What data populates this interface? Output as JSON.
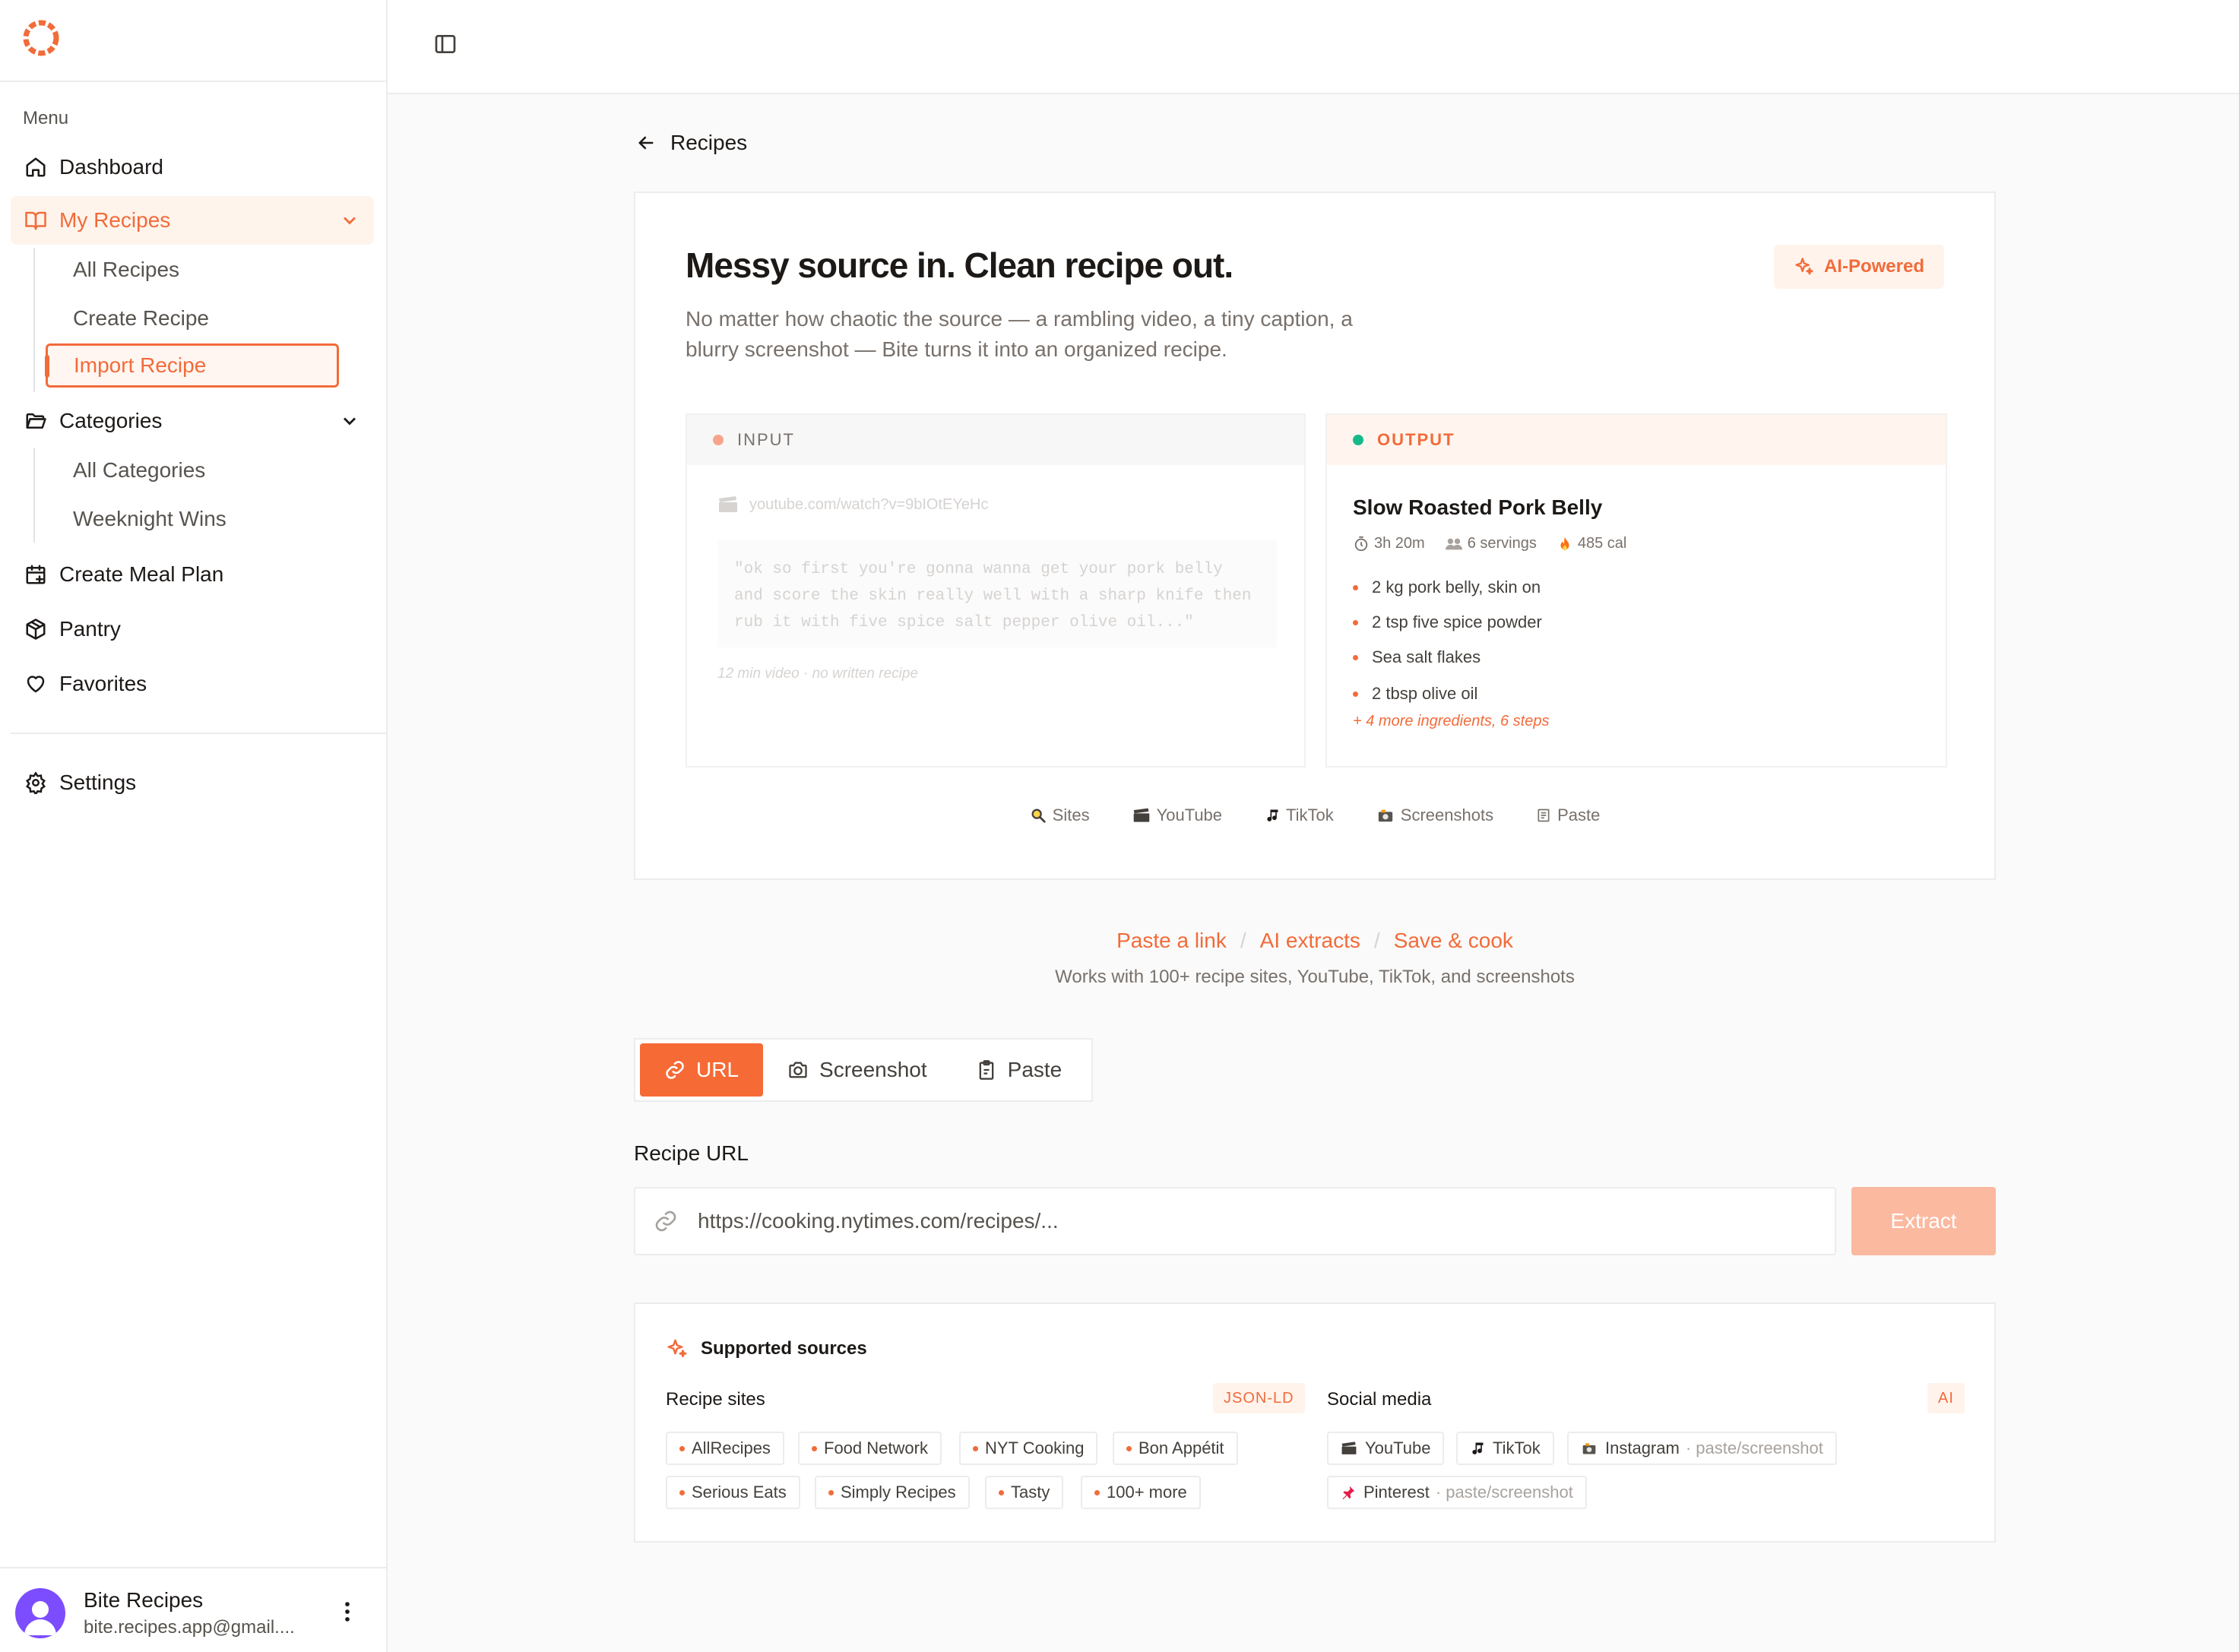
{
  "sidebar": {
    "menu_label": "Menu",
    "items": {
      "dashboard": "Dashboard",
      "my_recipes": "My Recipes",
      "all_recipes": "All Recipes",
      "create_recipe": "Create Recipe",
      "import_recipe": "Import Recipe",
      "categories": "Categories",
      "all_categories": "All Categories",
      "weeknight_wins": "Weeknight Wins",
      "meal_plan": "Create Meal Plan",
      "pantry": "Pantry",
      "favorites": "Favorites",
      "settings": "Settings"
    },
    "user": {
      "name": "Bite Recipes",
      "email": "bite.recipes.app@gmail...."
    }
  },
  "colors": {
    "accent": "#f26b3a",
    "accent_light": "#fff3ec",
    "avatar": "#7c4dff",
    "output_dot": "#16b98a",
    "input_dot": "#f7a58a"
  },
  "back_label": "Recipes",
  "hero": {
    "title": "Messy source in. Clean recipe out.",
    "description": "No matter how chaotic the source — a rambling video, a tiny caption, a blurry screenshot — Bite turns it into an organized recipe.",
    "badge": "AI-Powered",
    "input": {
      "header": "INPUT",
      "url": "youtube.com/watch?v=9bIOtEYeHc",
      "quote": "\"ok so first you're gonna wanna get your pork belly and score the skin really well with a sharp knife then rub it with five spice salt pepper olive oil...\"",
      "note": "12 min video · no written recipe"
    },
    "output": {
      "header": "OUTPUT",
      "title": "Slow Roasted Pork Belly",
      "time": "3h 20m",
      "servings": "6 servings",
      "calories": "485 cal",
      "ingredients": [
        "2 kg pork belly, skin on",
        "2 tsp five spice powder",
        "Sea salt flakes",
        "2 tbsp olive oil"
      ],
      "more": "+ 4 more ingredients, 6 steps"
    },
    "sources": [
      "Sites",
      "YouTube",
      "TikTok",
      "Screenshots",
      "Paste"
    ]
  },
  "steps": [
    "Paste a link",
    "AI extracts",
    "Save & cook"
  ],
  "works_with": "Works with 100+ recipe sites, YouTube, TikTok, and screenshots",
  "tabs": {
    "url": "URL",
    "screenshot": "Screenshot",
    "paste": "Paste"
  },
  "form": {
    "label": "Recipe URL",
    "placeholder": "https://cooking.nytimes.com/recipes/...",
    "button": "Extract"
  },
  "supported": {
    "title": "Supported sources",
    "recipe_sites": {
      "title": "Recipe sites",
      "badge": "JSON-LD",
      "items": [
        "AllRecipes",
        "Food Network",
        "NYT Cooking",
        "Bon Appétit",
        "Serious Eats",
        "Simply Recipes",
        "Tasty",
        "100+ more"
      ]
    },
    "social": {
      "title": "Social media",
      "badge": "AI",
      "items": [
        "YouTube",
        "TikTok",
        "Instagram",
        "Pinterest"
      ],
      "note": "paste/screenshot"
    }
  }
}
